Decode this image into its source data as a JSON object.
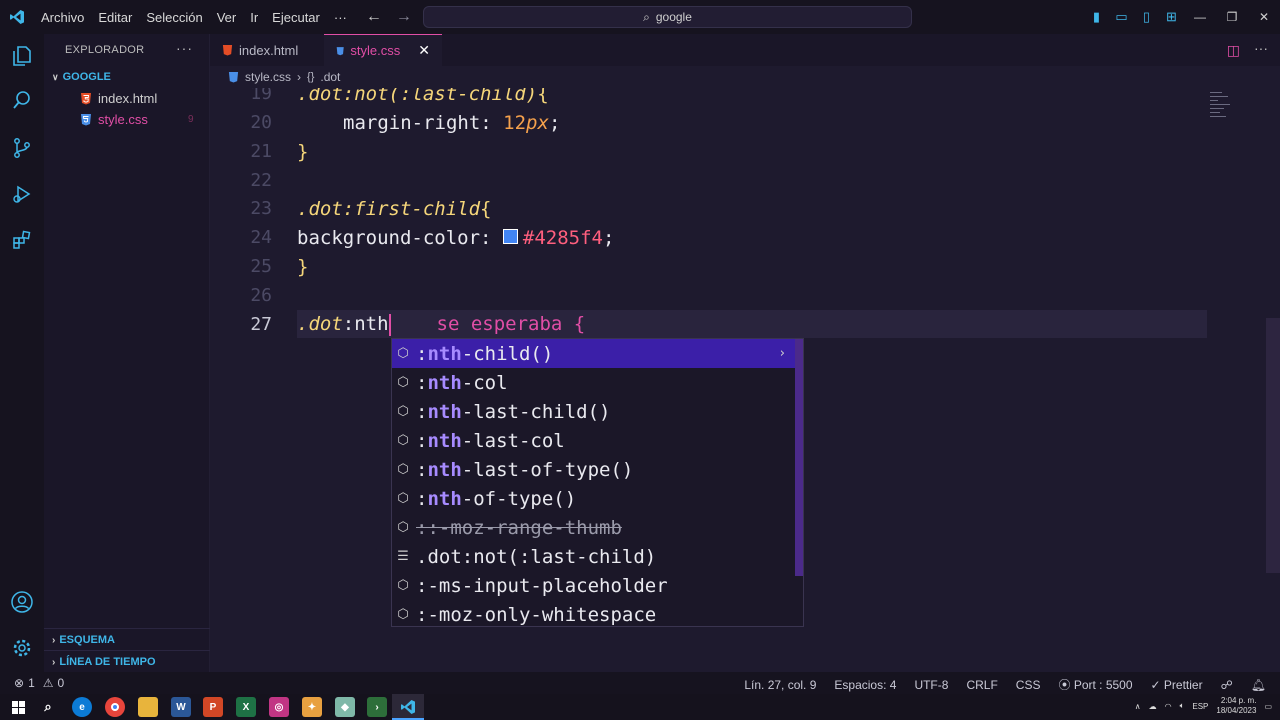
{
  "titlebar": {
    "menu": [
      "Archivo",
      "Editar",
      "Selección",
      "Ver",
      "Ir",
      "Ejecutar",
      "···"
    ],
    "search": "google"
  },
  "sidebar": {
    "title": "EXPLORADOR",
    "folder": "GOOGLE",
    "files": [
      {
        "name": "index.html",
        "icon": "html-file-icon"
      },
      {
        "name": "style.css",
        "icon": "css-file-icon",
        "modified_marker": "9"
      }
    ],
    "sections": [
      "ESQUEMA",
      "LÍNEA DE TIEMPO"
    ]
  },
  "tabs": [
    {
      "label": "index.html",
      "active": false
    },
    {
      "label": "style.css",
      "active": true
    }
  ],
  "breadcrumb": {
    "file": "style.css",
    "symbol": ".dot"
  },
  "editor": {
    "lines": [
      {
        "num": "19",
        "selector": ".dot:not(:last-child)",
        "brace": "{"
      },
      {
        "num": "20",
        "prop": "margin-right: ",
        "value": "12",
        "unit": "px",
        "end": ";"
      },
      {
        "num": "21",
        "brace": "}"
      },
      {
        "num": "22"
      },
      {
        "num": "23",
        "selector": ".dot:first-child",
        "brace": "{"
      },
      {
        "num": "24",
        "prop": "background-color: ",
        "hex": "#4285f4",
        "end": ";"
      },
      {
        "num": "25",
        "brace": "}"
      },
      {
        "num": "26"
      },
      {
        "num": "27",
        "typed_prefix": ".dot",
        "typed_pseudo": ":nth",
        "hint": "se esperaba {"
      }
    ],
    "swatch_color": "#4285f4"
  },
  "suggestions": [
    {
      "pre": ":",
      "match": "nth",
      "post": "-child()",
      "active": true
    },
    {
      "pre": ":",
      "match": "nth",
      "post": "-col"
    },
    {
      "pre": ":",
      "match": "nth",
      "post": "-last-child()"
    },
    {
      "pre": ":",
      "match": "nth",
      "post": "-last-col"
    },
    {
      "pre": ":",
      "match": "nth",
      "post": "-last-of-type()"
    },
    {
      "pre": ":",
      "match": "nth",
      "post": "-of-type()"
    },
    {
      "text": "::-moz-range-thumb",
      "deprecated": true
    },
    {
      "text": ".dot:not(:last-child)",
      "kind": "snippet"
    },
    {
      "text": ":-ms-input-placeholder"
    },
    {
      "text": ":-moz-only-whitespace"
    }
  ],
  "statusbar": {
    "errors": "1",
    "warnings": "0",
    "position": "Lín. 27, col. 9",
    "spaces": "Espacios: 4",
    "encoding": "UTF-8",
    "eol": "CRLF",
    "language": "CSS",
    "port": "Port : 5500",
    "prettier": "Prettier"
  },
  "taskbar": {
    "lang": "ESP",
    "time": "2:04 p. m.",
    "date": "18/04/2023"
  },
  "colors": {
    "accent": "#e14ea6",
    "folder": "#3fb6e8",
    "selection": "#3b1fa8"
  }
}
